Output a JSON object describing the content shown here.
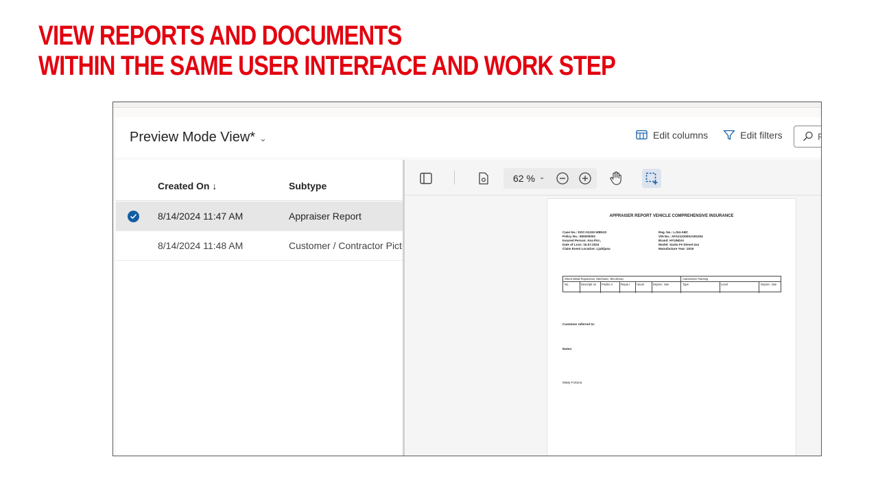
{
  "headline": {
    "line1": "VIEW REPORTS AND DOCUMENTS",
    "line2": "WITHIN THE SAME USER INTERFACE AND WORK STEP"
  },
  "viewbar": {
    "title": "Preview Mode View*",
    "edit_columns": "Edit columns",
    "edit_filters": "Edit filters",
    "search_placeholder": "F"
  },
  "grid": {
    "columns": [
      "Created On ↓",
      "Subtype"
    ],
    "rows": [
      {
        "created_on": "8/14/2024 11:47 AM",
        "subtype": "Appraiser Report",
        "selected": true
      },
      {
        "created_on": "8/14/2024 11:48 AM",
        "subtype": "Customer / Contractor Pictu",
        "selected": false
      }
    ]
  },
  "preview": {
    "zoom": "62 %",
    "document": {
      "title": "APPRAISER REPORT VEHICLE COMPREHENSIVE INSURANCE",
      "left_info": [
        "Case No.: DOC-01333-W8N1S",
        "Policy No.: 800000002",
        "Insured Person: Ana Pirc,",
        "Date of Loss: 16.07.2024",
        "Claim Event Location: Ljubljana"
      ],
      "right_info": [
        "Reg. No.: LJ34-ABC",
        "VIN No.: AFA2122000JA81004",
        "Brand: HYUNDAI",
        "Model: Santa Fe Diesel 4x4",
        "Manufacture Year: 2019"
      ],
      "table_group_1": "Sheet Metal Repairman, Mechanic, Electrician",
      "table_group_2": "Automotive Painting",
      "table_cols": [
        "No.",
        "Descripti on",
        "Positio n",
        "Repai r",
        "Hours",
        "Deprec. rate",
        "Type",
        "Level",
        "Deprec. rate"
      ],
      "customer_referred": "Customer referred to:",
      "notes": "Notes:",
      "signature": "Matej Fortuna"
    }
  }
}
